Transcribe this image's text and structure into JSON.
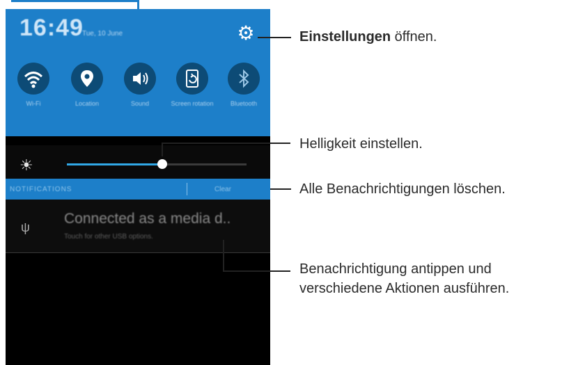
{
  "status": {
    "time": "16:49",
    "date": "Tue, 10 June"
  },
  "quick_settings": [
    {
      "label": "Wi-Fi",
      "icon": "wifi-icon"
    },
    {
      "label": "Location",
      "icon": "location-icon"
    },
    {
      "label": "Sound",
      "icon": "sound-icon"
    },
    {
      "label": "Screen rotation",
      "icon": "screen-rotation-icon"
    },
    {
      "label": "Bluetooth",
      "icon": "bluetooth-icon"
    }
  ],
  "brightness": {
    "level": 0.53
  },
  "notifications_bar": {
    "title": "NOTIFICATIONS",
    "clear": "Clear"
  },
  "notification": {
    "title": "Connected as a media d..",
    "subtitle": "Touch for other USB options."
  },
  "annotations": {
    "settings_bold": "Einstellungen",
    "settings_rest": " öffnen.",
    "brightness": "Helligkeit einstellen.",
    "clear": "Alle Benachrichtigungen löschen.",
    "notification_line1": "Benachrichtigung antippen und",
    "notification_line2": "verschiedene Aktionen ausführen."
  },
  "colors": {
    "accent": "#1d7fc9",
    "slider": "#31a8e6"
  }
}
